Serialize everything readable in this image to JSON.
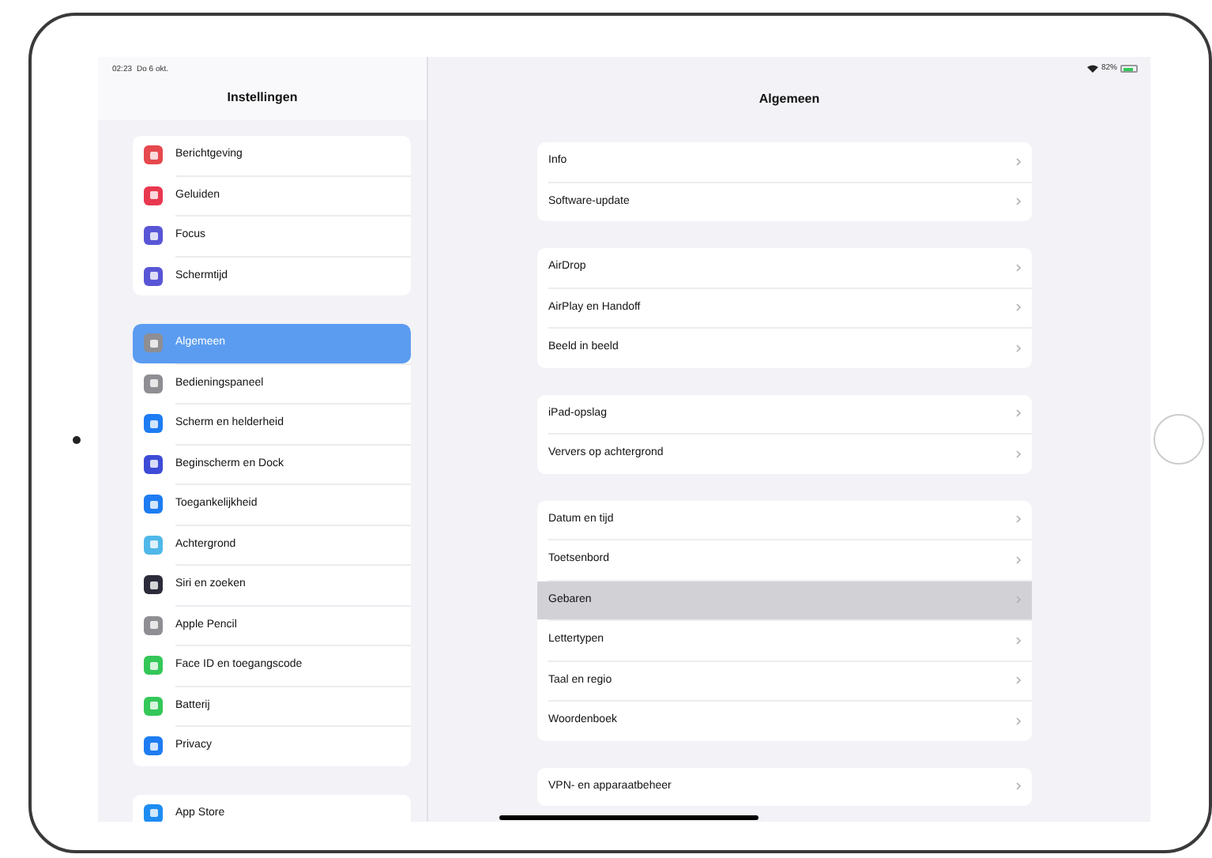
{
  "status_bar": {
    "time": "02:23",
    "date": "Do 6 okt.",
    "battery": "82%"
  },
  "sidebar": {
    "title": "Instellingen",
    "groups": [
      [
        {
          "label": "Berichtgeving",
          "color": "#e5484d",
          "selected": false
        },
        {
          "label": "Geluiden",
          "color": "#e8384f",
          "selected": false
        },
        {
          "label": "Focus",
          "color": "#5856d6",
          "selected": false
        },
        {
          "label": "Schermtijd",
          "color": "#5856d6",
          "selected": false
        }
      ],
      [
        {
          "label": "Algemeen",
          "color": "#8e8e93",
          "selected": true
        },
        {
          "label": "Bedieningspaneel",
          "color": "#8e8e93",
          "selected": false
        },
        {
          "label": "Scherm en helderheid",
          "color": "#1e7cf2",
          "selected": false
        },
        {
          "label": "Beginscherm en Dock",
          "color": "#3d4bd6",
          "selected": false
        },
        {
          "label": "Toegankelijkheid",
          "color": "#1e7cf2",
          "selected": false
        },
        {
          "label": "Achtergrond",
          "color": "#4fb8e8",
          "selected": false
        },
        {
          "label": "Siri en zoeken",
          "color": "#2b2b3a",
          "selected": false
        },
        {
          "label": "Apple Pencil",
          "color": "#8e8e93",
          "selected": false
        },
        {
          "label": "Face ID en toegangscode",
          "color": "#34c759",
          "selected": false
        },
        {
          "label": "Batterij",
          "color": "#34c759",
          "selected": false
        },
        {
          "label": "Privacy",
          "color": "#1e7cf2",
          "selected": false
        }
      ],
      [
        {
          "label": "App Store",
          "color": "#1e8cf2",
          "selected": false
        }
      ]
    ]
  },
  "detail": {
    "title": "Algemeen",
    "groups": [
      [
        {
          "label": "Info",
          "selected": false
        },
        {
          "label": "Software-update",
          "selected": false
        }
      ],
      [
        {
          "label": "AirDrop",
          "selected": false
        },
        {
          "label": "AirPlay en Handoff",
          "selected": false
        },
        {
          "label": "Beeld in beeld",
          "selected": false
        }
      ],
      [
        {
          "label": "iPad-opslag",
          "selected": false
        },
        {
          "label": "Ververs op achtergrond",
          "selected": false
        }
      ],
      [
        {
          "label": "Datum en tijd",
          "selected": false
        },
        {
          "label": "Toetsenbord",
          "selected": false
        },
        {
          "label": "Gebaren",
          "selected": true
        },
        {
          "label": "Lettertypen",
          "selected": false
        },
        {
          "label": "Taal en regio",
          "selected": false
        },
        {
          "label": "Woordenboek",
          "selected": false
        }
      ],
      [
        {
          "label": "VPN- en apparaatbeheer",
          "selected": false
        }
      ]
    ]
  }
}
